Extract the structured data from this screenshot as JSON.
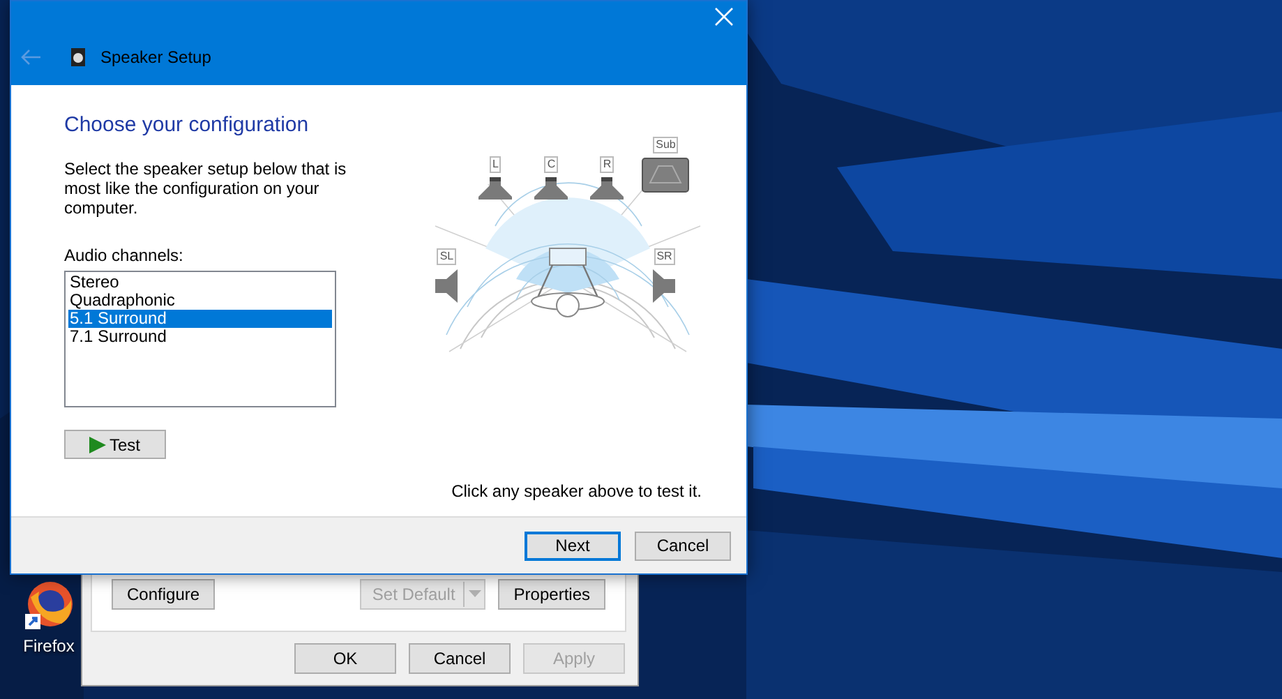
{
  "desktop": {
    "icons": [
      {
        "label": "Firefox"
      }
    ]
  },
  "back_window": {
    "buttons": [
      {
        "label": "Configure",
        "disabled": false,
        "kind": "plain"
      },
      {
        "label": "Set Default",
        "disabled": true,
        "kind": "split"
      },
      {
        "label": "Properties",
        "disabled": false,
        "kind": "plain"
      }
    ],
    "footer_buttons": [
      {
        "label": "OK",
        "disabled": false
      },
      {
        "label": "Cancel",
        "disabled": false
      },
      {
        "label": "Apply",
        "disabled": true
      }
    ]
  },
  "dialog": {
    "title": "Speaker Setup",
    "heading": "Choose your configuration",
    "description": "Select the speaker setup below that is most like the configuration on your computer.",
    "list_label": "Audio channels:",
    "channels": [
      {
        "label": "Stereo",
        "selected": false
      },
      {
        "label": "Quadraphonic",
        "selected": false
      },
      {
        "label": "5.1 Surround",
        "selected": true
      },
      {
        "label": "7.1 Surround",
        "selected": false
      }
    ],
    "test_button": "Test",
    "speakers": [
      {
        "label": "L",
        "kind": "front"
      },
      {
        "label": "C",
        "kind": "front"
      },
      {
        "label": "R",
        "kind": "front"
      },
      {
        "label": "Sub",
        "kind": "sub"
      },
      {
        "label": "SL",
        "kind": "side-left"
      },
      {
        "label": "SR",
        "kind": "side-right"
      }
    ],
    "hint": "Click any speaker above to test it.",
    "buttons": [
      {
        "label": "Next",
        "default": true
      },
      {
        "label": "Cancel",
        "default": false
      }
    ]
  }
}
